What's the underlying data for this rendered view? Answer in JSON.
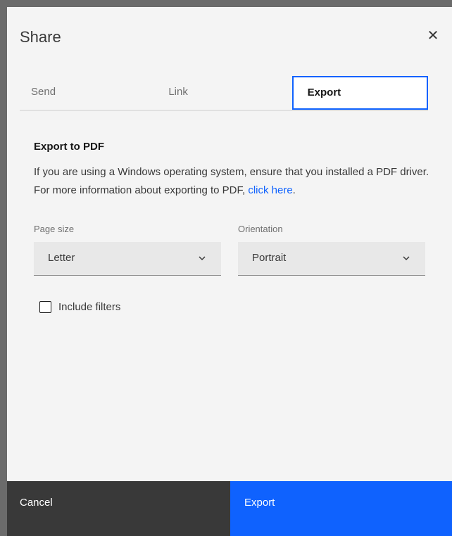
{
  "dialog": {
    "title": "Share",
    "close_symbol": "✕"
  },
  "tabs": [
    {
      "label": "Send",
      "active": false
    },
    {
      "label": "Link",
      "active": false
    },
    {
      "label": "Export",
      "active": true
    }
  ],
  "export_pdf": {
    "heading": "Export to PDF",
    "description": "If you are using a Windows operating system, ensure that you installed a PDF driver. For more information about exporting to PDF, ",
    "link_text": "click here",
    "trailing": "."
  },
  "page_size": {
    "label": "Page size",
    "value": "Letter"
  },
  "orientation": {
    "label": "Orientation",
    "value": "Portrait"
  },
  "include_filters": {
    "label": "Include filters",
    "checked": false
  },
  "footer": {
    "cancel_label": "Cancel",
    "export_label": "Export"
  },
  "colors": {
    "accent": "#0f62fe",
    "footer_secondary": "#393939",
    "background": "#f4f4f4"
  },
  "icons": {
    "close": "close-icon",
    "dropdown": "chevron-down-icon",
    "checkbox": "checkbox-unchecked-icon"
  }
}
